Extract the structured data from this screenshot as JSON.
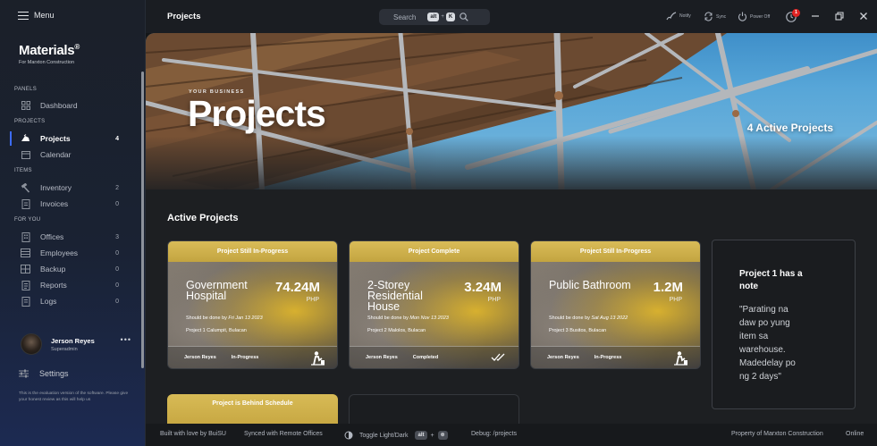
{
  "sidebar": {
    "menu_label": "Menu",
    "brand_name": "Materials",
    "brand_mark": "®",
    "brand_sub": "For Marxton Construction",
    "sections": {
      "panels": "PANELS",
      "projects": "PROJECTS",
      "items": "ITEMS",
      "for_you": "FOR YOU"
    },
    "items": [
      {
        "label": "Dashboard",
        "count": "",
        "icon": "dashboard-icon"
      },
      {
        "label": "Projects",
        "count": "4",
        "icon": "projects-icon",
        "active": true
      },
      {
        "label": "Calendar",
        "count": "",
        "icon": "calendar-icon"
      },
      {
        "label": "Inventory",
        "count": "2",
        "icon": "hammer-icon"
      },
      {
        "label": "Invoices",
        "count": "0",
        "icon": "invoice-icon"
      },
      {
        "label": "Offices",
        "count": "3",
        "icon": "building-icon"
      },
      {
        "label": "Employees",
        "count": "0",
        "icon": "employees-icon"
      },
      {
        "label": "Backup",
        "count": "0",
        "icon": "backup-icon"
      },
      {
        "label": "Reports",
        "count": "0",
        "icon": "reports-icon"
      },
      {
        "label": "Logs",
        "count": "0",
        "icon": "logs-icon"
      }
    ],
    "user": {
      "name": "Jerson Reyes",
      "role": "Superadmin",
      "more": "•••"
    },
    "settings_label": "Settings",
    "eval_note": "This is the evaluation version of the software. Please give your honest review as this will help us"
  },
  "topbar": {
    "page_name": "Projects",
    "search_placeholder": "Search",
    "search_key1": "alt",
    "search_plus": "+",
    "search_key2": "K",
    "notify_label": "Notify",
    "sync_label": "Sync",
    "power_label": "Power Off",
    "notif_count": "1"
  },
  "hero": {
    "eyebrow": "YOUR BUSINESS",
    "title": "Projects",
    "count_text": "4 Active Projects"
  },
  "main": {
    "section_title": "Active Projects",
    "cards": [
      {
        "header": "Project Still In-Progress",
        "title": "Government Hospital",
        "amount": "74.24M",
        "currency": "PHP",
        "due_prefix": "Should be done by",
        "due_date": "Fri Jan 13 2023",
        "location": "Project 1 Calumpit, Bulacan",
        "owner": "Jerson Reyes",
        "status": "In-Progress",
        "status_icon": "worker-icon"
      },
      {
        "header": "Project Complete",
        "title": "2-Storey Residential House",
        "amount": "3.24M",
        "currency": "PHP",
        "due_prefix": "Should be done by",
        "due_date": "Mon Nov 13 2023",
        "location": "Project 2 Malolos, Bulacan",
        "owner": "Jerson Reyes",
        "status": "Completed",
        "status_icon": "double-check-icon"
      },
      {
        "header": "Project Still In-Progress",
        "title": "Public Bathroom",
        "amount": "1.2M",
        "currency": "PHP",
        "due_prefix": "Should be done by",
        "due_date": "Sat Aug 13 2022",
        "location": "Project 3 Busitos, Bulacan",
        "owner": "Jerson Reyes",
        "status": "In-Progress",
        "status_icon": "worker-icon"
      }
    ],
    "note": {
      "title": "Project 1 has a note",
      "body": "\"Parating na daw po yung item sa warehouse. Madedelay po ng 2 days\""
    },
    "partial_card_header": "Project is Behind Schedule"
  },
  "statusbar": {
    "built_with": "Built with love by BuiSU",
    "synced": "Synced with Remote Offices",
    "toggle": "Toggle Light/Dark",
    "toggle_key1": "alt",
    "toggle_plus": "+",
    "toggle_key2": "⊗",
    "debug": "Debug: /projects",
    "property": "Property of Marxton Construction",
    "online": "Online"
  },
  "colors": {
    "accent": "#3d6cff",
    "card_gold": "#d4b551",
    "badge_red": "#e02424"
  }
}
